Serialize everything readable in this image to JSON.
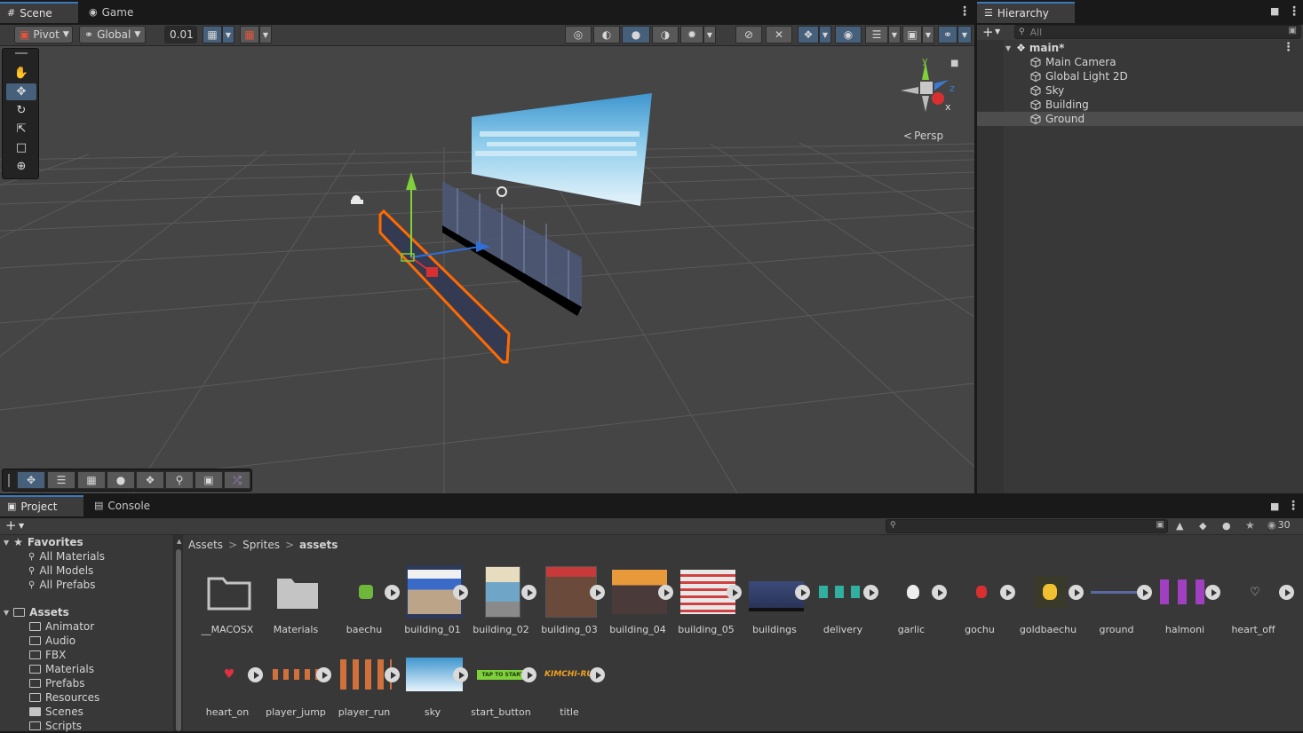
{
  "scene_tabs": {
    "scene": "Scene",
    "game": "Game"
  },
  "scene_toolbar": {
    "pivot": "Pivot",
    "global": "Global",
    "snap_value": "0.01",
    "persp_label": "Persp"
  },
  "gizmo": {
    "y": "y",
    "z": "z",
    "x": "x"
  },
  "hierarchy": {
    "tab": "Hierarchy",
    "search_placeholder": "All",
    "scene_name": "main*",
    "items": [
      "Main Camera",
      "Global Light 2D",
      "Sky",
      "Building",
      "Ground"
    ]
  },
  "project_tabs": {
    "project": "Project",
    "console": "Console"
  },
  "project_toolbar": {
    "visible_count": "30"
  },
  "breadcrumb": [
    "Assets",
    "Sprites",
    "assets"
  ],
  "tree": {
    "favorites": "Favorites",
    "favorite_items": [
      "All Materials",
      "All Models",
      "All Prefabs"
    ],
    "assets": "Assets",
    "asset_folders": [
      "Animator",
      "Audio",
      "FBX",
      "Materials",
      "Prefabs",
      "Resources",
      "Scenes",
      "Scripts"
    ]
  },
  "assets_row1": [
    "__MACOSX",
    "Materials",
    "baechu",
    "building_01",
    "building_02",
    "building_03",
    "building_04",
    "building_05",
    "buildings",
    "delivery",
    "garlic",
    "gochu",
    "goldbaechu",
    "ground",
    "halmoni",
    "heart_off"
  ],
  "assets_row2": [
    "heart_on",
    "player_jump",
    "player_run",
    "sky",
    "start_button",
    "title"
  ],
  "thumb_text": {
    "start_button": "TAP TO START",
    "title": "KIMCHI-RU"
  },
  "colors": {
    "accent": "#3a79bb",
    "selection_outline": "#ff6a00",
    "selected_button": "#46607c"
  }
}
